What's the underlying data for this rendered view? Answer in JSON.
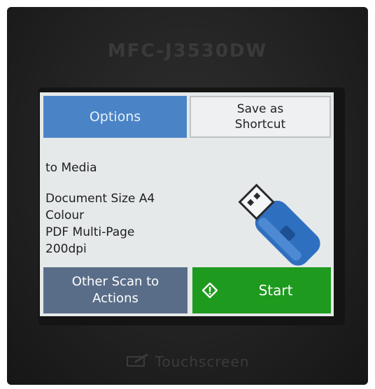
{
  "device": {
    "model": "MFC-J3530DW",
    "brand_label": "Touchscreen"
  },
  "screen": {
    "options_label": "Options",
    "shortcut_label_line1": "Save as",
    "shortcut_label_line2": "Shortcut",
    "destination": "to Media",
    "settings": [
      "Document Size A4",
      "Colour",
      "PDF Multi-Page",
      "200dpi"
    ],
    "other_label_line1": "Other Scan to",
    "other_label_line2": "Actions",
    "start_label": "Start"
  },
  "colors": {
    "options_blue": "#4a84c6",
    "start_green": "#1e9a1e",
    "other_slate": "#5a6d88",
    "usb_blue": "#2f6fc0"
  },
  "icons": {
    "usb": "usb-flash-drive-icon",
    "start": "start-diamond-icon",
    "touch": "touchscreen-icon"
  }
}
